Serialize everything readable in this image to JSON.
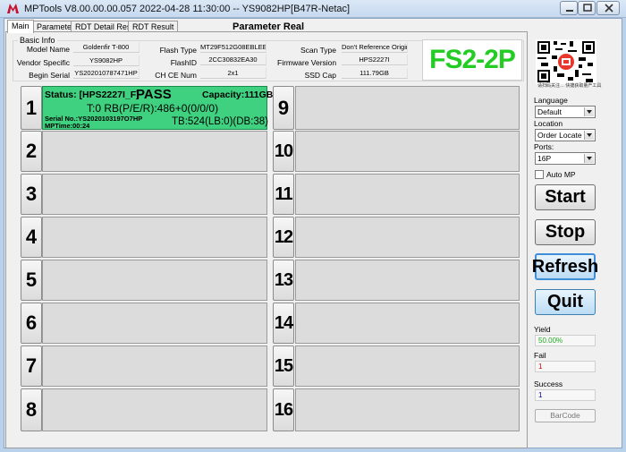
{
  "window": {
    "title": "MPTools V8.00.00.00.057 2022-04-28 11:30:00   -- YS9082HP[B47R-Netac]"
  },
  "tabs": [
    {
      "label": "Main",
      "active": true
    },
    {
      "label": "Parameter",
      "active": false
    },
    {
      "label": "RDT Detail Result",
      "active": false
    },
    {
      "label": "RDT Result",
      "active": false
    }
  ],
  "header": {
    "param_title": "Parameter  Real"
  },
  "basic_info": {
    "legend": "Basic Info",
    "model_name_label": "Model Name",
    "model_name": "Goldenfir T-800",
    "vendor_specific_label": "Vendor Specific",
    "vendor_specific": "YS9082HP",
    "begin_serial_label": "Begin Serial",
    "begin_serial": "YS202010787471HP",
    "flash_type_label": "Flash Type",
    "flash_type": "MT29F512G08EBLEE(B4",
    "flash_id_label": "FlashID",
    "flash_id": "2CC30832EA30",
    "ch_ce_num_label": "CH CE Num",
    "ch_ce_num": "2x1",
    "scan_type_label": "Scan Type",
    "scan_type": "Don't Reference Origina",
    "firmware_version_label": "Firmware Version",
    "firmware_version": "HPS2227I",
    "ssd_cap_label": "SSD Cap",
    "ssd_cap": "111.79GB"
  },
  "fs_label": "FS2-2P",
  "ports": {
    "left": [
      "1",
      "2",
      "3",
      "4",
      "5",
      "6",
      "7",
      "8"
    ],
    "right": [
      "9",
      "10",
      "11",
      "12",
      "13",
      "14",
      "15",
      "16"
    ],
    "port1": {
      "status": "Status:  [HPS2227I_F]",
      "result": "PASS",
      "capacity": "Capacity:111GB",
      "line2": "T:0 RB(P/E/R):486+0(0/0/0)",
      "serial": "Serial No.:YS2020103197O7HP",
      "mptime": "MPTime:00:24",
      "tb": "TB:524(LB:0)(DB:38)",
      "color": "#3fd17f"
    }
  },
  "sidebar": {
    "qr_caption": "请扫码关注… 快捷获取量产工具",
    "language_label": "Language",
    "language_value": "Default",
    "location_label": "Location",
    "location_value": "Order Locate",
    "ports_label": "Ports:",
    "ports_value": "16P",
    "auto_mp_label": "Auto MP",
    "start": "Start",
    "stop": "Stop",
    "refresh": "Refresh",
    "quit": "Quit",
    "yield_label": "Yield",
    "yield_value": "50.00%",
    "fail_label": "Fail",
    "fail_value": "1",
    "success_label": "Success",
    "success_value": "1",
    "barcode": "BarCode",
    "colors": {
      "yield": "#22aa22",
      "fail": "#cc0000",
      "success": "#0000aa"
    }
  }
}
